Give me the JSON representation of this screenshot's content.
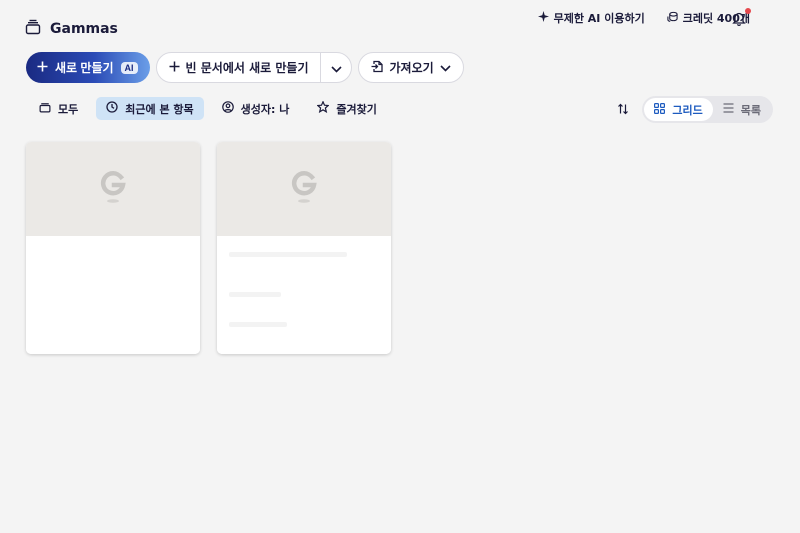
{
  "workspace": {
    "name": "Gammas"
  },
  "header": {
    "ai_link": "무제한 AI 이용하기",
    "credits": "크레딧 400개"
  },
  "actions": {
    "new_ai_label": "새로 만들기",
    "ai_badge": "AI",
    "new_blank_label": "빈 문서에서 새로 만들기",
    "import_label": "가져오기"
  },
  "filters": [
    {
      "label": "모두",
      "active": false
    },
    {
      "label": "최근에 본 항목",
      "active": true
    },
    {
      "label": "생성자: 나",
      "active": false
    },
    {
      "label": "즐겨찾기",
      "active": false
    }
  ],
  "view_toggle": {
    "grid_label": "그리드",
    "list_label": "목록",
    "selected": "grid"
  },
  "cards": [
    {
      "thumb_icon": "gamma-logo-icon"
    },
    {
      "thumb_icon": "gamma-logo-icon"
    }
  ],
  "colors": {
    "brand_dark": "#1a2a82",
    "active_filter_bg": "#cfe3f6",
    "grid_selected": "#1d5bbf",
    "notification_dot": "#e5484d"
  }
}
